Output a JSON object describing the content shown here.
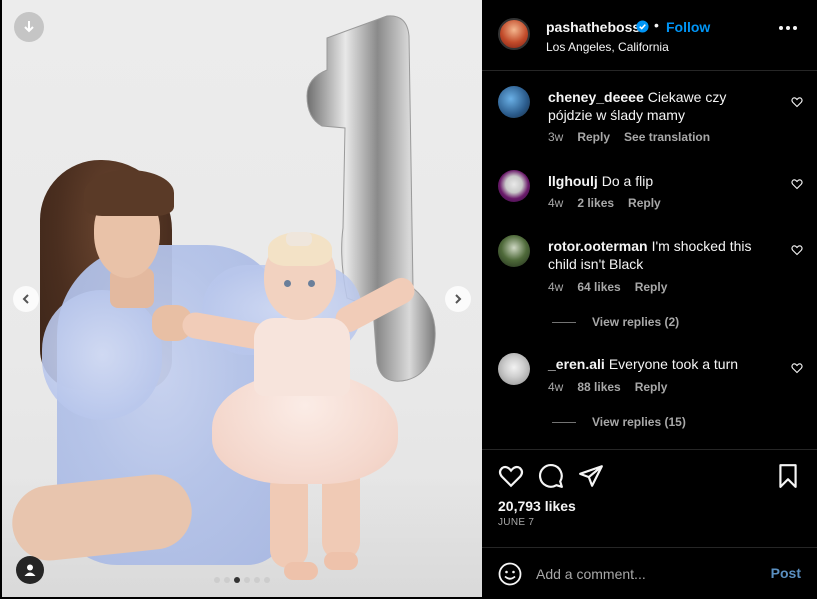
{
  "post": {
    "username": "pashatheboss",
    "location": "Los Angeles, California",
    "follow_label": "Follow",
    "separator": "•",
    "likes": "20,793 likes",
    "date": "JUNE 7",
    "carousel": {
      "total": 6,
      "active_index": 2
    }
  },
  "comments": [
    {
      "username": "cheney_deeee",
      "text": "Ciekawe czy pójdzie w ślady mamy",
      "time": "3w",
      "likes": "",
      "reply": "Reply",
      "translate": "See translation",
      "view_replies": ""
    },
    {
      "username": "llghoulj",
      "text": "Do a flip",
      "time": "4w",
      "likes": "2 likes",
      "reply": "Reply",
      "translate": "",
      "view_replies": ""
    },
    {
      "username": "rotor.ooterman",
      "text": "I'm shocked this child isn't Black",
      "time": "4w",
      "likes": "64 likes",
      "reply": "Reply",
      "translate": "",
      "view_replies": "View replies (2)"
    },
    {
      "username": "_eren.ali",
      "text": "Everyone took a turn",
      "time": "4w",
      "likes": "88 likes",
      "reply": "Reply",
      "translate": "",
      "view_replies": "View replies (15)"
    }
  ],
  "add_comment": {
    "placeholder": "Add a comment...",
    "post_label": "Post"
  },
  "colors": {
    "accent": "#0095f6",
    "background": "#000000",
    "muted": "#a8a8a8",
    "divider": "#262626"
  },
  "icons": [
    "download-icon",
    "chevron-left-icon",
    "chevron-right-icon",
    "user-tag-icon",
    "verified-badge-icon",
    "more-options-icon",
    "heart-icon",
    "comment-icon",
    "share-icon",
    "bookmark-icon",
    "emoji-icon"
  ]
}
